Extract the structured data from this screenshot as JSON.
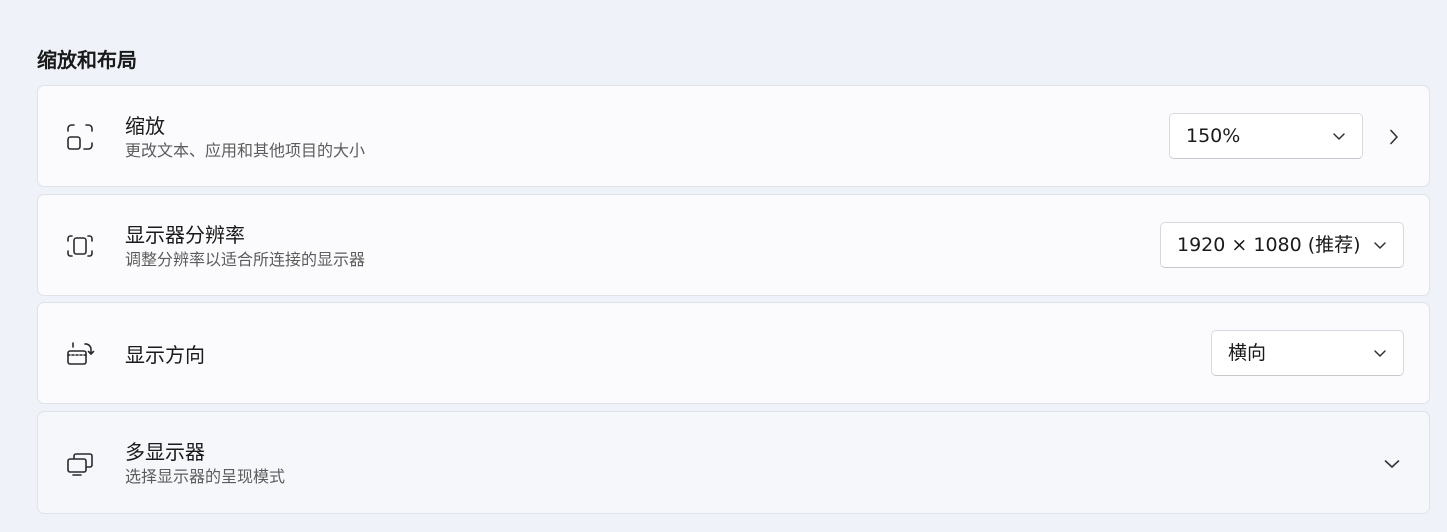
{
  "section": {
    "title": "缩放和布局"
  },
  "scale": {
    "icon": "scale-icon",
    "title": "缩放",
    "subtitle": "更改文本、应用和其他项目的大小",
    "value": "150%"
  },
  "resolution": {
    "icon": "resolution-icon",
    "title": "显示器分辨率",
    "subtitle": "调整分辨率以适合所连接的显示器",
    "value": "1920 × 1080 (推荐)"
  },
  "orientation": {
    "icon": "orientation-icon",
    "title": "显示方向",
    "value": "横向"
  },
  "multi_display": {
    "icon": "multiple-displays-icon",
    "title": "多显示器",
    "subtitle": "选择显示器的呈现模式"
  }
}
